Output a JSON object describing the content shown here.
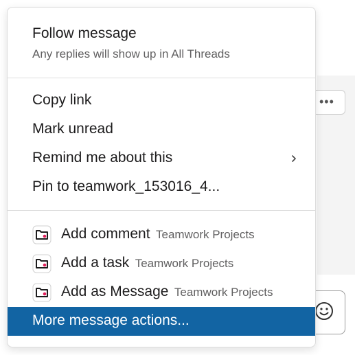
{
  "menu": {
    "follow": {
      "label": "Follow message",
      "description": "Any replies will show up in All Threads"
    },
    "copy_link": "Copy link",
    "mark_unread": "Mark unread",
    "remind": "Remind me about this",
    "pin": "Pin to teamwork_153016_4...",
    "app_actions": [
      {
        "label": "Add comment",
        "source": "Teamwork Projects",
        "icon": "folder-icon"
      },
      {
        "label": "Add a task",
        "source": "Teamwork Projects",
        "icon": "folder-icon"
      },
      {
        "label": "Add as Message",
        "source": "Teamwork Projects",
        "icon": "folder-icon"
      }
    ],
    "more_actions": "More message actions..."
  },
  "colors": {
    "highlight": "#1264a3",
    "icon_accent": "#e01e5a"
  }
}
